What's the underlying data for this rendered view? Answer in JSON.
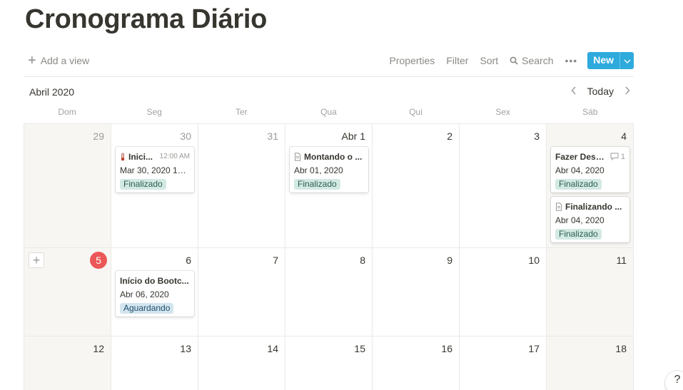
{
  "page": {
    "title": "Cronograma Diário"
  },
  "toolbar": {
    "add_view": "Add a view",
    "properties": "Properties",
    "filter": "Filter",
    "sort": "Sort",
    "search": "Search",
    "more": "•••",
    "new": "New"
  },
  "calendar": {
    "month": "Abril 2020",
    "today": "Today",
    "weekdays": [
      "Dom",
      "Seg",
      "Ter",
      "Qua",
      "Qui",
      "Sex",
      "Sáb"
    ],
    "current_day": "5",
    "weeks": [
      [
        "29",
        "30",
        "31",
        "Abr 1",
        "2",
        "3",
        "4"
      ],
      [
        "5",
        "6",
        "7",
        "8",
        "9",
        "10",
        "11"
      ],
      [
        "12",
        "13",
        "14",
        "15",
        "16",
        "17",
        "18"
      ]
    ]
  },
  "events": [
    {
      "title": "Inici...",
      "time": "12:00 AM",
      "date": "Mar 30, 2020 12:...",
      "status": "Finalizado",
      "icon": "thermometer-icon"
    },
    {
      "title": "Montando o ...",
      "date": "Abr 01, 2020",
      "status": "Finalizado",
      "icon": "page-icon"
    },
    {
      "title": "Fazer Desa...",
      "comments": "1",
      "date": "Abr 04, 2020",
      "status": "Finalizado"
    },
    {
      "title": "Finalizando ...",
      "date": "Abr 04, 2020",
      "status": "Finalizado",
      "icon": "page-icon"
    },
    {
      "title": "Início do Bootc...",
      "date": "Abr 06, 2020",
      "status": "Aguardando"
    }
  ],
  "colors": {
    "accent": "#2eaadc",
    "today_badge": "#eb5757",
    "tag_finalizado": "#d3e9e3",
    "tag_aguardando": "#d3e5ef",
    "weekend_bg": "#f7f6f3"
  },
  "help": {
    "label": "?"
  }
}
